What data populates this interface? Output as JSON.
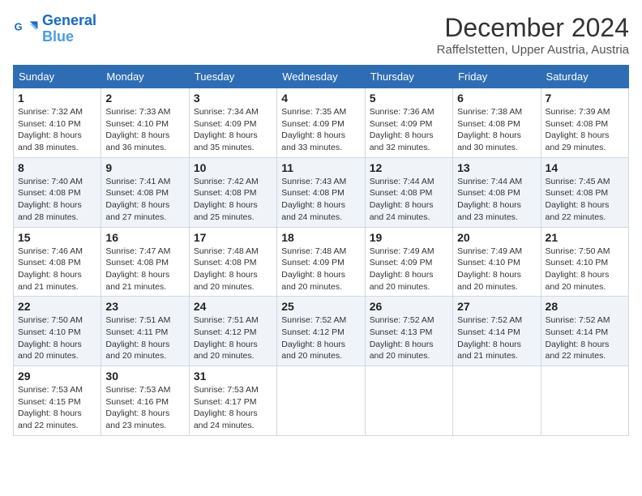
{
  "logo": {
    "line1": "General",
    "line2": "Blue"
  },
  "title": "December 2024",
  "location": "Raffelstetten, Upper Austria, Austria",
  "days_of_week": [
    "Sunday",
    "Monday",
    "Tuesday",
    "Wednesday",
    "Thursday",
    "Friday",
    "Saturday"
  ],
  "weeks": [
    [
      {
        "day": "1",
        "sunrise": "7:32 AM",
        "sunset": "4:10 PM",
        "daylight": "8 hours and 38 minutes."
      },
      {
        "day": "2",
        "sunrise": "7:33 AM",
        "sunset": "4:10 PM",
        "daylight": "8 hours and 36 minutes."
      },
      {
        "day": "3",
        "sunrise": "7:34 AM",
        "sunset": "4:09 PM",
        "daylight": "8 hours and 35 minutes."
      },
      {
        "day": "4",
        "sunrise": "7:35 AM",
        "sunset": "4:09 PM",
        "daylight": "8 hours and 33 minutes."
      },
      {
        "day": "5",
        "sunrise": "7:36 AM",
        "sunset": "4:09 PM",
        "daylight": "8 hours and 32 minutes."
      },
      {
        "day": "6",
        "sunrise": "7:38 AM",
        "sunset": "4:08 PM",
        "daylight": "8 hours and 30 minutes."
      },
      {
        "day": "7",
        "sunrise": "7:39 AM",
        "sunset": "4:08 PM",
        "daylight": "8 hours and 29 minutes."
      }
    ],
    [
      {
        "day": "8",
        "sunrise": "7:40 AM",
        "sunset": "4:08 PM",
        "daylight": "8 hours and 28 minutes."
      },
      {
        "day": "9",
        "sunrise": "7:41 AM",
        "sunset": "4:08 PM",
        "daylight": "8 hours and 27 minutes."
      },
      {
        "day": "10",
        "sunrise": "7:42 AM",
        "sunset": "4:08 PM",
        "daylight": "8 hours and 25 minutes."
      },
      {
        "day": "11",
        "sunrise": "7:43 AM",
        "sunset": "4:08 PM",
        "daylight": "8 hours and 24 minutes."
      },
      {
        "day": "12",
        "sunrise": "7:44 AM",
        "sunset": "4:08 PM",
        "daylight": "8 hours and 24 minutes."
      },
      {
        "day": "13",
        "sunrise": "7:44 AM",
        "sunset": "4:08 PM",
        "daylight": "8 hours and 23 minutes."
      },
      {
        "day": "14",
        "sunrise": "7:45 AM",
        "sunset": "4:08 PM",
        "daylight": "8 hours and 22 minutes."
      }
    ],
    [
      {
        "day": "15",
        "sunrise": "7:46 AM",
        "sunset": "4:08 PM",
        "daylight": "8 hours and 21 minutes."
      },
      {
        "day": "16",
        "sunrise": "7:47 AM",
        "sunset": "4:08 PM",
        "daylight": "8 hours and 21 minutes."
      },
      {
        "day": "17",
        "sunrise": "7:48 AM",
        "sunset": "4:08 PM",
        "daylight": "8 hours and 20 minutes."
      },
      {
        "day": "18",
        "sunrise": "7:48 AM",
        "sunset": "4:09 PM",
        "daylight": "8 hours and 20 minutes."
      },
      {
        "day": "19",
        "sunrise": "7:49 AM",
        "sunset": "4:09 PM",
        "daylight": "8 hours and 20 minutes."
      },
      {
        "day": "20",
        "sunrise": "7:49 AM",
        "sunset": "4:10 PM",
        "daylight": "8 hours and 20 minutes."
      },
      {
        "day": "21",
        "sunrise": "7:50 AM",
        "sunset": "4:10 PM",
        "daylight": "8 hours and 20 minutes."
      }
    ],
    [
      {
        "day": "22",
        "sunrise": "7:50 AM",
        "sunset": "4:10 PM",
        "daylight": "8 hours and 20 minutes."
      },
      {
        "day": "23",
        "sunrise": "7:51 AM",
        "sunset": "4:11 PM",
        "daylight": "8 hours and 20 minutes."
      },
      {
        "day": "24",
        "sunrise": "7:51 AM",
        "sunset": "4:12 PM",
        "daylight": "8 hours and 20 minutes."
      },
      {
        "day": "25",
        "sunrise": "7:52 AM",
        "sunset": "4:12 PM",
        "daylight": "8 hours and 20 minutes."
      },
      {
        "day": "26",
        "sunrise": "7:52 AM",
        "sunset": "4:13 PM",
        "daylight": "8 hours and 20 minutes."
      },
      {
        "day": "27",
        "sunrise": "7:52 AM",
        "sunset": "4:14 PM",
        "daylight": "8 hours and 21 minutes."
      },
      {
        "day": "28",
        "sunrise": "7:52 AM",
        "sunset": "4:14 PM",
        "daylight": "8 hours and 22 minutes."
      }
    ],
    [
      {
        "day": "29",
        "sunrise": "7:53 AM",
        "sunset": "4:15 PM",
        "daylight": "8 hours and 22 minutes."
      },
      {
        "day": "30",
        "sunrise": "7:53 AM",
        "sunset": "4:16 PM",
        "daylight": "8 hours and 23 minutes."
      },
      {
        "day": "31",
        "sunrise": "7:53 AM",
        "sunset": "4:17 PM",
        "daylight": "8 hours and 24 minutes."
      },
      null,
      null,
      null,
      null
    ]
  ]
}
